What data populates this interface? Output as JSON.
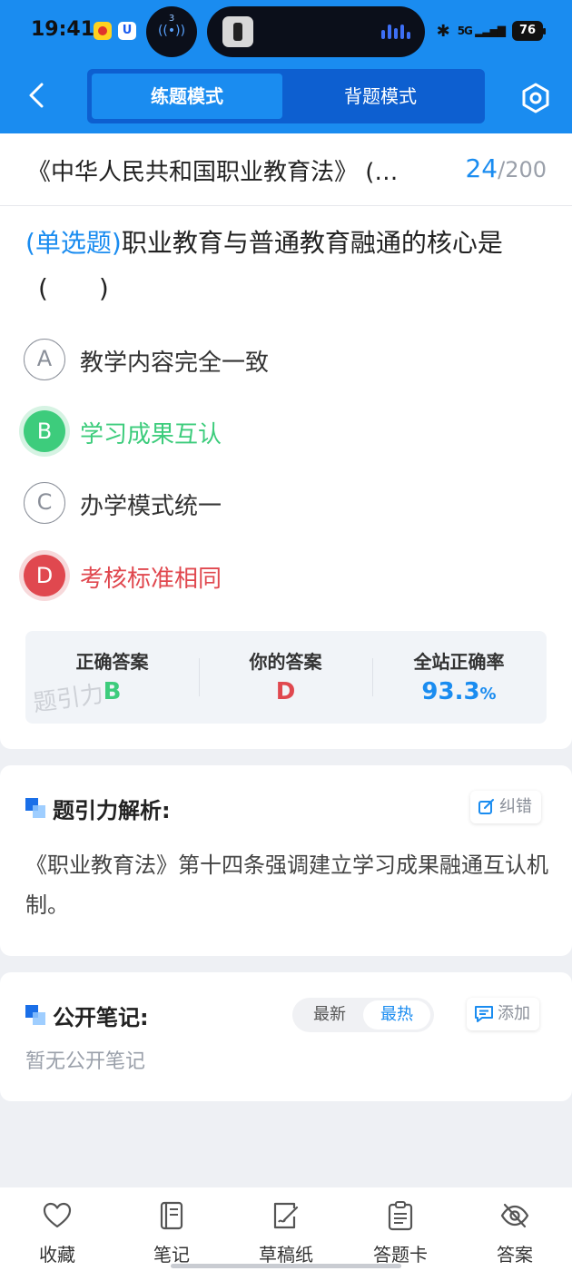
{
  "status_bar": {
    "time": "19:41",
    "app_badge": "U",
    "island_count": "3",
    "signal": "5G",
    "battery": "76"
  },
  "header": {
    "tabs": [
      {
        "label": "练题模式"
      },
      {
        "label": "背题模式"
      }
    ]
  },
  "doc": {
    "title": "《中华人民共和国职业教育法》",
    "current": "24",
    "separator": "/",
    "total": "200"
  },
  "question": {
    "type": "(单选题)",
    "text": "职业教育与普通教育融通的核心是",
    "blank": "(　　)",
    "options": [
      {
        "letter": "A",
        "text": "教学内容完全一致"
      },
      {
        "letter": "B",
        "text": "学习成果互认"
      },
      {
        "letter": "C",
        "text": "办学模式统一"
      },
      {
        "letter": "D",
        "text": "考核标准相同"
      }
    ]
  },
  "result": {
    "correct_label": "正确答案",
    "correct_value": "B",
    "your_label": "你的答案",
    "your_value": "D",
    "rate_label": "全站正确率",
    "rate_value": "93.3",
    "rate_unit": "%",
    "watermark": "题引力"
  },
  "analysis": {
    "title": "题引力解析:",
    "report_label": "纠错",
    "text": "《职业教育法》第十四条强调建立学习成果融通互认机制。"
  },
  "notes": {
    "title": "公开笔记:",
    "sort_options": [
      "最新",
      "最热"
    ],
    "add_label": "添加",
    "empty_text": "暂无公开笔记"
  },
  "bottom_nav": [
    {
      "label": "收藏",
      "icon": "heart-icon"
    },
    {
      "label": "笔记",
      "icon": "notebook-icon"
    },
    {
      "label": "草稿纸",
      "icon": "draft-icon"
    },
    {
      "label": "答题卡",
      "icon": "answer-card-icon"
    },
    {
      "label": "答案",
      "icon": "eye-off-icon"
    }
  ],
  "colors": {
    "brand_blue": "#1a8cf0",
    "correct_green": "#3dcc7c",
    "wrong_red": "#e0484f"
  }
}
